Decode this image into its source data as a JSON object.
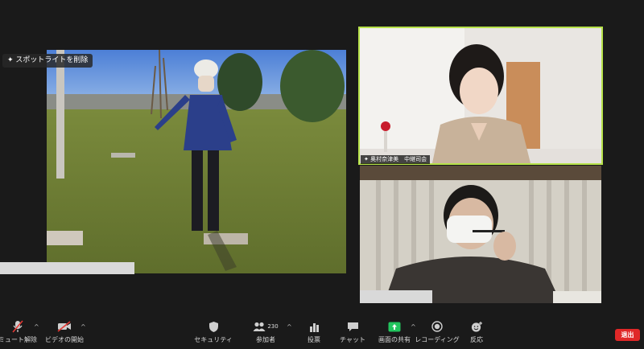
{
  "spotlight": {
    "label": "スポットライトを削除"
  },
  "presenter": {
    "name_tag": "奥村奈津美　中継司会"
  },
  "toolbar": {
    "mute": {
      "label": "ミュート解除"
    },
    "video": {
      "label": "ビデオの開始"
    },
    "security": {
      "label": "セキュリティ"
    },
    "participants": {
      "label": "参加者",
      "count": "230"
    },
    "polls": {
      "label": "投票"
    },
    "chat": {
      "label": "チャット"
    },
    "share": {
      "label": "画面の共有"
    },
    "record": {
      "label": "レコーディング"
    },
    "reactions": {
      "label": "反応"
    },
    "leave": {
      "label": "退出"
    }
  },
  "colors": {
    "share_green": "#22c55e",
    "leave_red": "#e02828",
    "active_speaker": "#b7e24a",
    "mute_red": "#e53935"
  }
}
